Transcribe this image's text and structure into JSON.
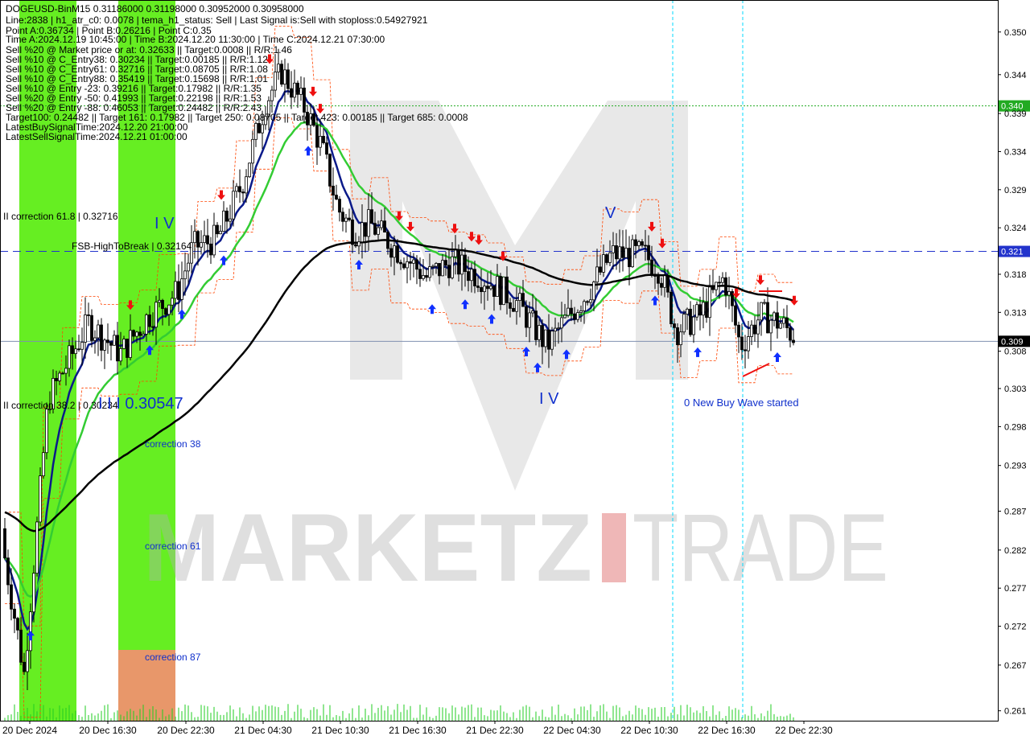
{
  "chart_data": {
    "type": "candlestick",
    "symbol_line": "DOGEUSD-BinM15  0.31186000 0.31198000 0.30952000 0.30958000",
    "y_ticks": [
      "0.350",
      "0.344",
      "0.339",
      "0.334",
      "0.329",
      "0.324",
      "0.318",
      "0.313",
      "0.308",
      "0.303",
      "0.298",
      "0.293",
      "0.287",
      "0.282",
      "0.277",
      "0.272",
      "0.267",
      "0.261"
    ],
    "y_tick_values": [
      0.3502,
      0.3446,
      0.3395,
      0.3345,
      0.3295,
      0.3245,
      0.3184,
      0.3134,
      0.3083,
      0.3034,
      0.2984,
      0.2933,
      0.2873,
      0.2822,
      0.2772,
      0.2722,
      0.2671,
      0.2611
    ],
    "ylim": [
      0.2598,
      0.3544
    ],
    "x_ticks": [
      "20 Dec 2024",
      "20 Dec 16:30",
      "20 Dec 22:30",
      "21 Dec 04:30",
      "21 Dec 10:30",
      "21 Dec 16:30",
      "21 Dec 22:30",
      "22 Dec 04:30",
      "22 Dec 10:30",
      "22 Dec 16:30",
      "22 Dec 22:30"
    ],
    "info_lines": [
      "Line:2838  |  h1_atr_c0: 0.0078  |  tema_h1_status: Sell  |  Last Signal is:Sell with stoploss:0.54927921",
      "Point A:0.36734  |  Point B:0.26216  |  Point C:0.35",
      "Time A:2024.12.19 10:45:00  |  Time B:2024.12.20 11:30:00  |  Time C:2024.12.21 07:30:00",
      "Sell %20 @ Market price or at: 0.32633  ||  Target:0.0008  ||  R/R:1.46",
      "Sell %10 @ C_Entry38: 0.30234  ||  Target:0.00185  ||  R/R:1.12",
      "Sell %10 @ C_Entry61: 0.32716  ||  Target:0.08705  ||  R/R:1.08",
      "Sell %10 @ C_Entry88: 0.35419  ||  Target:0.15698  ||  R/R:1.01",
      "Sell %10 @ Entry -23: 0.39216  ||  Target:0.17982  ||  R/R:1.35",
      "Sell %20 @ Entry -50: 0.41993  ||  Target:0.22198  ||  R/R:1.53",
      "Sell %20 @ Entry -88: 0.46053  ||  Target:0.24482  ||  R/R:2.43",
      "Target100: 0.24482  ||  Target 161: 0.17982  ||  Target 250: 0.08705  ||  Target 423: 0.00185  ||  Target 685: 0.0008",
      "LatestBuySignalTime:2024.12.20 21:00:00",
      "LatestSellSignalTime:2024.12.21 01:00:00"
    ],
    "price_levels": [
      {
        "label": "0.340",
        "value": 0.3405,
        "color": "#22aa22"
      },
      {
        "label": "0.321",
        "value": 0.3214,
        "color": "#2233cc"
      },
      {
        "label": "0.309",
        "value": 0.3096,
        "color": "#000000"
      }
    ],
    "annotations": {
      "fsb": "FSB-HighToBreak | 0.32164",
      "corr618": "II correction 61.8 | 0.32716",
      "corr382": "II correction 38.2 | 0.30234",
      "iii_value": "I I I 0.30547",
      "wave_iv_left": "I V",
      "wave_v": "V",
      "wave_iv_mid": "I V",
      "new_wave": "0 New Buy Wave started",
      "corr38": "correction 38",
      "corr61": "correction 61",
      "corr87": "correction 87"
    },
    "watermark": {
      "part1": "MARKETZ",
      "part2": "TRADE"
    },
    "colors": {
      "bull_body": "#ffffff",
      "candle": "#000000",
      "ma_fast": "#0a1a8a",
      "ma_mid": "#33cc33",
      "ma_slow": "#000000",
      "channel": "#ff4400",
      "zone_green": "#66ee22",
      "zone_orange": "#e8976a",
      "cyan": "#00d8ff",
      "buy_arrow": "#1030ff",
      "sell_arrow": "#ee1010"
    }
  }
}
